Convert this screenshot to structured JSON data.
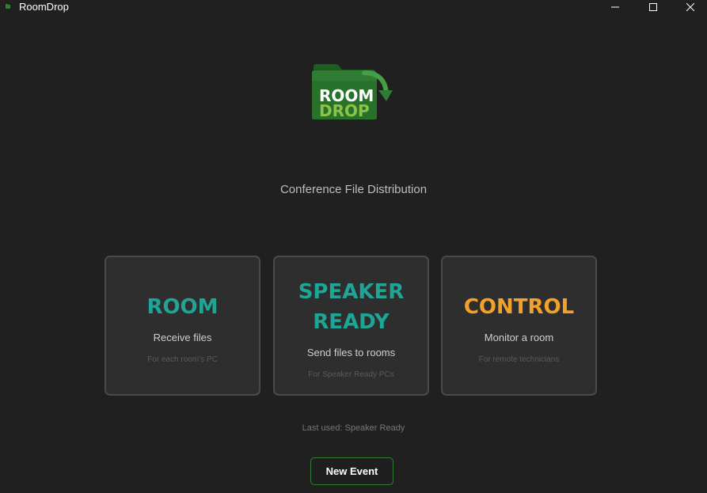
{
  "window": {
    "title": "RoomDrop",
    "controls": [
      "minimize-icon",
      "maximize-icon",
      "close-icon"
    ]
  },
  "logo": {
    "line1": "ROOM",
    "line2": "DROP"
  },
  "subtitle": "Conference File Distribution",
  "cards": {
    "room": {
      "title": "ROOM",
      "description": "Receive files",
      "hint": "For each room's PC"
    },
    "speaker": {
      "title_line1": "SPEAKER",
      "title_line2": "READY",
      "description": "Send files to rooms",
      "hint": "For Speaker Ready PCs"
    },
    "control": {
      "title": "CONTROL",
      "description": "Monitor a room",
      "hint": "For remote technicians"
    }
  },
  "last_used": "Last used: Speaker Ready",
  "new_event_label": "New Event",
  "colors": {
    "background": "#202020",
    "card_background": "#2e2e2e",
    "teal_accent": "#1fa596",
    "orange_accent": "#f2a22b",
    "green_border": "#2e7d32"
  }
}
